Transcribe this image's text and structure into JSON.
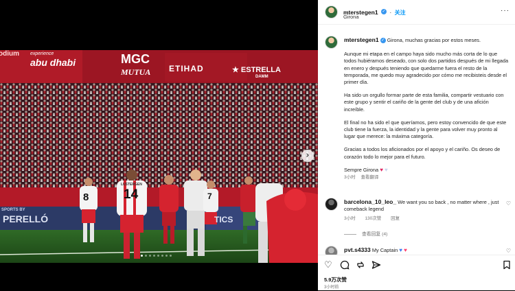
{
  "header": {
    "username": "mterstegen1",
    "follow_label": "关注",
    "location": "Girona",
    "verified_symbol": "✓",
    "more_symbol": "···"
  },
  "photo": {
    "sponsors": [
      "odium",
      "experience",
      "abu dhabi",
      "MGC",
      "MUTUA",
      "ETIHAD",
      "★ ESTRELLA",
      "DAMM",
      "SPORTS BY",
      "PERELLÓ",
      "TICS"
    ],
    "jersey_numbers": [
      "8",
      "14",
      "7"
    ],
    "jersey_names": [
      "LUSTERGEN"
    ],
    "next_icon": "›",
    "slide_count": 8,
    "active_slide": 1
  },
  "caption": {
    "username": "mterstegen1",
    "intro": "Girona, muchas gracias por estos meses.",
    "paragraphs": [
      "Aunque mi etapa en el campo haya sido mucho más corta de lo que todos hubiéramos deseado, con solo dos partidos después de mi llegada en enero y después teniendo que quedarme fuera el resto de la temporada, me quedo muy agradecido por cómo me recibisteis desde el primer día.",
      "Ha sido un orgullo formar parte de esta familia, compartir vestuario con este grupo y sentir el cariño de la gente del club y de una afición increíble.",
      "El final no ha sido el que queríamos, pero estoy convencido de que este club tiene la fuerza, la identidad y la gente para volver muy pronto al lugar que merece: la máxima categoría.",
      "Gracias a todos los aficionados por el apoyo y el cariño. Os deseo de corazón todo lo mejor para el futuro."
    ],
    "sign_off": "Sempre Girona",
    "time": "3小时",
    "see_translation": "查看翻译"
  },
  "comments": [
    {
      "username": "barcelona_10_leo_",
      "text": "We want you so back , no matter where , just comeback legend",
      "time": "3小时",
      "likes": "130次赞",
      "reply": "回复",
      "view_replies": "查看回复 (4)"
    },
    {
      "username": "pvt.s4333",
      "text": "My Captain"
    }
  ],
  "actions": {
    "likes_count": "5.9万次赞",
    "time_ago": "3小时前"
  },
  "colors": {
    "follow_blue": "#0095f6",
    "verified_blue": "#3897f0",
    "girona_red": "#d5232f"
  }
}
